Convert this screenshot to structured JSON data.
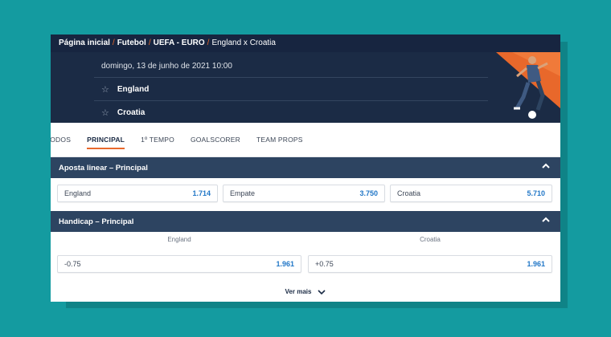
{
  "breadcrumb": {
    "home": "Página inicial",
    "sport": "Futebol",
    "league": "UEFA - EURO",
    "event": "England x Croatia",
    "separator": "/"
  },
  "event": {
    "datetime": "domingo, 13 de junho de 2021 10:00",
    "home_team": "England",
    "away_team": "Croatia"
  },
  "tabs": [
    {
      "label": "TODOS",
      "active": false
    },
    {
      "label": "PRINCIPAL",
      "active": true
    },
    {
      "label": "1º TEMPO",
      "active": false
    },
    {
      "label": "GOALSCORER",
      "active": false
    },
    {
      "label": "TEAM PROPS",
      "active": false
    }
  ],
  "market_linear": {
    "title": "Aposta linear – Principal",
    "outcomes": [
      {
        "label": "England",
        "odd": "1.714"
      },
      {
        "label": "Empate",
        "odd": "3.750"
      },
      {
        "label": "Croatia",
        "odd": "5.710"
      }
    ]
  },
  "market_handicap": {
    "title": "Handicap – Principal",
    "columns": [
      "England",
      "Croatia"
    ],
    "outcomes": [
      {
        "label": "-0.75",
        "odd": "1.961"
      },
      {
        "label": "+0.75",
        "odd": "1.961"
      }
    ]
  },
  "more_label": "Ver mais",
  "colors": {
    "header_bg": "#1b2b45",
    "section_bg": "#2d4461",
    "accent": "#e8682b",
    "odd_value": "#2277c7",
    "page_bg": "#149ba0"
  }
}
